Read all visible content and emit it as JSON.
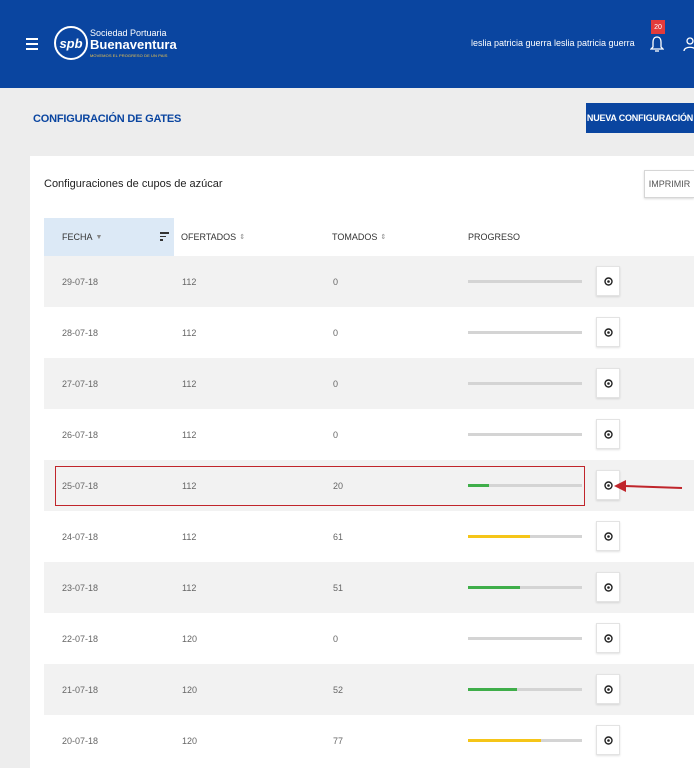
{
  "header": {
    "logo_mark": "spb",
    "logo_line1": "Sociedad Portuaria",
    "logo_line2": "Buenaventura",
    "logo_line3": "MOVEMOS EL PROGRESO DE UN PAIS",
    "user_name": "leslia patricia guerra leslia patricia guerra",
    "notification_count": "20",
    "colors": {
      "primary": "#0a45a0",
      "badge": "#e33b3b"
    }
  },
  "page": {
    "title": "CONFIGURACIÓN DE GATES",
    "new_button": "NUEVA CONFIGURACIÓN"
  },
  "card": {
    "title": "Configuraciones de cupos de azúcar",
    "print_button": "IMPRIMIR"
  },
  "table": {
    "columns": {
      "fecha": "FECHA",
      "ofertados": "OFERTADOS",
      "tomados": "TOMADOS",
      "progreso": "PROGRESO"
    },
    "rows": [
      {
        "fecha": "29-07-18",
        "ofertados": "112",
        "tomados": "0",
        "progress": 0,
        "color": "#cfcfcf"
      },
      {
        "fecha": "28-07-18",
        "ofertados": "112",
        "tomados": "0",
        "progress": 0,
        "color": "#cfcfcf"
      },
      {
        "fecha": "27-07-18",
        "ofertados": "112",
        "tomados": "0",
        "progress": 0,
        "color": "#cfcfcf"
      },
      {
        "fecha": "26-07-18",
        "ofertados": "112",
        "tomados": "0",
        "progress": 0,
        "color": "#cfcfcf"
      },
      {
        "fecha": "25-07-18",
        "ofertados": "112",
        "tomados": "20",
        "progress": 0.18,
        "color": "#3fae4a"
      },
      {
        "fecha": "24-07-18",
        "ofertados": "112",
        "tomados": "61",
        "progress": 0.54,
        "color": "#f5c518"
      },
      {
        "fecha": "23-07-18",
        "ofertados": "112",
        "tomados": "51",
        "progress": 0.46,
        "color": "#3fae4a"
      },
      {
        "fecha": "22-07-18",
        "ofertados": "120",
        "tomados": "0",
        "progress": 0,
        "color": "#cfcfcf"
      },
      {
        "fecha": "21-07-18",
        "ofertados": "120",
        "tomados": "52",
        "progress": 0.43,
        "color": "#3fae4a"
      },
      {
        "fecha": "20-07-18",
        "ofertados": "120",
        "tomados": "77",
        "progress": 0.64,
        "color": "#f5c518"
      }
    ]
  },
  "annotation": {
    "highlighted_row": "25-07-18",
    "color": "#c0252b"
  }
}
